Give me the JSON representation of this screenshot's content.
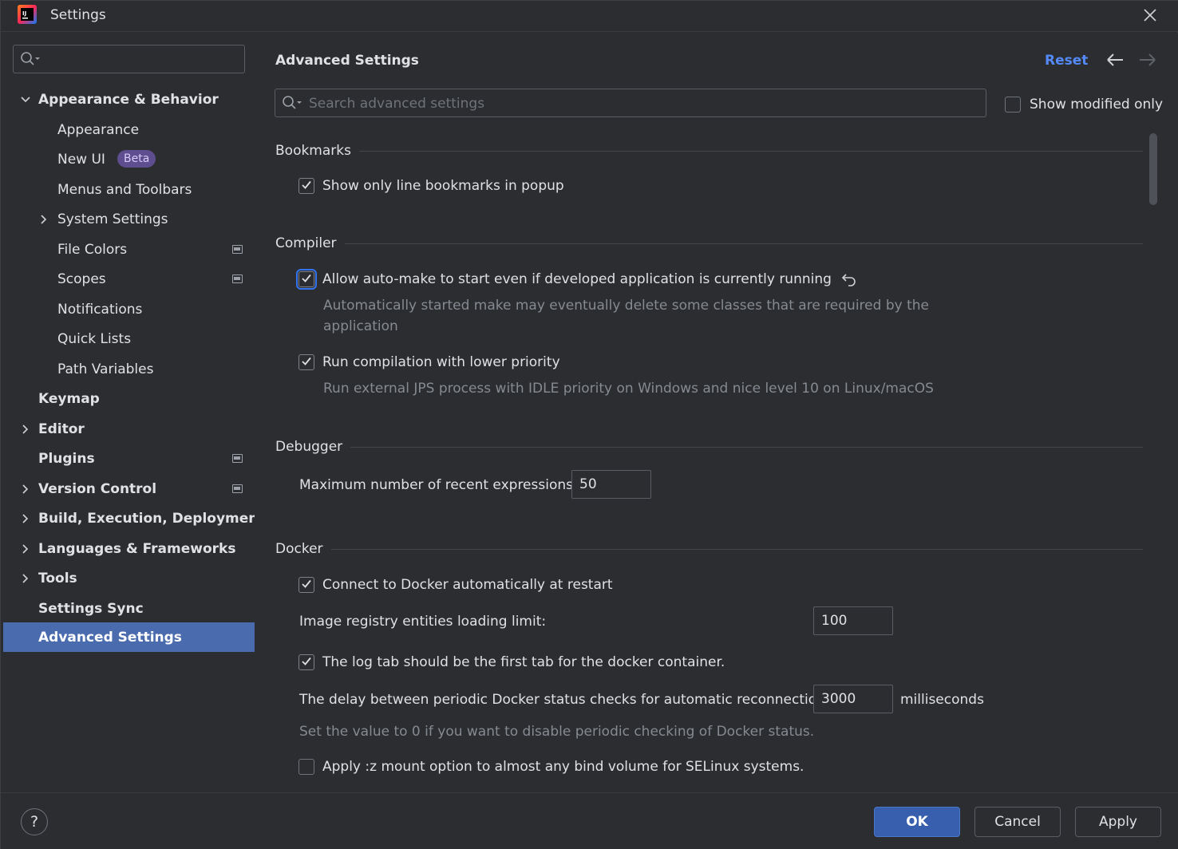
{
  "window": {
    "title": "Settings"
  },
  "sidebar": {
    "search_placeholder": "",
    "items": [
      {
        "label": "Appearance & Behavior",
        "expanded": true
      },
      {
        "label": "Appearance"
      },
      {
        "label": "New UI",
        "badge": "Beta"
      },
      {
        "label": "Menus and Toolbars"
      },
      {
        "label": "System Settings"
      },
      {
        "label": "File Colors"
      },
      {
        "label": "Scopes"
      },
      {
        "label": "Notifications"
      },
      {
        "label": "Quick Lists"
      },
      {
        "label": "Path Variables"
      },
      {
        "label": "Keymap"
      },
      {
        "label": "Editor"
      },
      {
        "label": "Plugins"
      },
      {
        "label": "Version Control"
      },
      {
        "label": "Build, Execution, Deployment"
      },
      {
        "label": "Languages & Frameworks"
      },
      {
        "label": "Tools"
      },
      {
        "label": "Settings Sync"
      },
      {
        "label": "Advanced Settings",
        "selected": true
      }
    ]
  },
  "main": {
    "title": "Advanced Settings",
    "reset_label": "Reset",
    "search_placeholder": "Search advanced settings",
    "show_modified_label": "Show modified only",
    "sections": {
      "bookmarks": {
        "title": "Bookmarks",
        "show_line_bookmarks": "Show only line bookmarks in popup"
      },
      "compiler": {
        "title": "Compiler",
        "auto_make": "Allow auto-make to start even if developed application is currently running",
        "auto_make_hint_1": "Automatically started make may eventually delete some classes that are required by the",
        "auto_make_hint_2": "application",
        "lower_priority": "Run compilation with lower priority",
        "lower_priority_hint": "Run external JPS process with IDLE priority on Windows and nice level 10 on Linux/macOS"
      },
      "debugger": {
        "title": "Debugger",
        "recent_expressions_label": "Maximum number of recent expressions:",
        "recent_expressions_value": "50"
      },
      "docker": {
        "title": "Docker",
        "connect_auto": "Connect to Docker automatically at restart",
        "registry_limit_label": "Image registry entities loading limit:",
        "registry_limit_value": "100",
        "log_tab_first": "The log tab should be the first tab for the docker container.",
        "delay_label": "The delay between periodic Docker status checks for automatic reconnection:",
        "delay_value": "3000",
        "delay_units": "milliseconds",
        "delay_hint": "Set the value to 0 if you want to disable periodic checking of Docker status.",
        "selinux_mount": "Apply :z mount option to almost any bind volume for SELinux systems."
      }
    }
  },
  "footer": {
    "help_label": "?",
    "ok_label": "OK",
    "cancel_label": "Cancel",
    "apply_label": "Apply"
  }
}
